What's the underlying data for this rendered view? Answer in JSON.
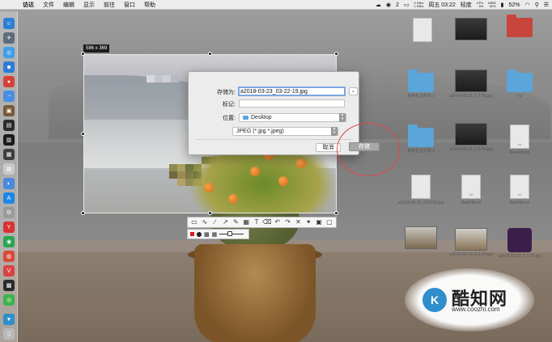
{
  "menubar": {
    "app_name": "访达",
    "items": [
      "文件",
      "编辑",
      "显示",
      "前往",
      "窗口",
      "帮助"
    ],
    "status": {
      "wechat_count": "2",
      "net_up": "0 KB/s",
      "net_down": "1 KB/s",
      "clock": "周五 03:22",
      "brightness": "轻度",
      "cpu_label": "CPU",
      "cpu_pct": "5%",
      "mem_label": "MEM",
      "mem_pct": "52%",
      "battery_pct": "52%"
    }
  },
  "screenshot_tool": {
    "size_label": "586 x 369"
  },
  "dialog": {
    "save_as_label": "存储为:",
    "filename": "a2018-03-23_03-22-19.jpg",
    "tags_label": "标记:",
    "location_label": "位置:",
    "location_value": "Desktop",
    "format_value": "JPEG (*.jpg *.jpeg)",
    "cancel_label": "取消",
    "save_label": "存储"
  },
  "desktop_files": [
    {
      "name": ""
    },
    {
      "name": "未命名文件夹 2"
    },
    {
      "name": "a2018-03-22_0 2-58.jpg"
    },
    {
      "name": "Fa"
    },
    {
      "name": "未命名文件夹 3"
    },
    {
      "name": "a2018-03-22_0 2-04.jpg"
    },
    {
      "name": "NewFile.txt"
    },
    {
      "name": "a2018-03-23_03 9-03.jpg"
    },
    {
      "name": "NewFile.txt"
    },
    {
      "name": "NewFile.txt"
    },
    {
      "name": "a2018-03-23_0 2-24.jpg"
    },
    {
      "name": "a2018-03-22_0 1-05.jpg"
    }
  ],
  "watermark": {
    "title": "酷知网",
    "url": "www.coozhi.com"
  },
  "colors": {
    "accent_blue": "#7ba7e0",
    "annotation_red": "#e24848",
    "folder_blue": "#5aa5da"
  }
}
